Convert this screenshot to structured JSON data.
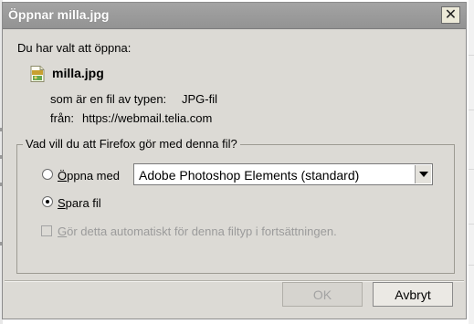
{
  "window": {
    "title": "Öppnar milla.jpg"
  },
  "intro_text": "Du har valt att öppna:",
  "file": {
    "name": "milla.jpg",
    "icon": "jpg-file-icon",
    "type_label": "som är en fil av typen:",
    "type_value": "JPG-fil",
    "from_label": "från:",
    "from_value": "https://webmail.telia.com"
  },
  "action_group": {
    "legend": "Vad vill du att Firefox gör med denna fil?",
    "open_with_label_accel": "Ö",
    "open_with_label_rest": "ppna med",
    "open_with_app": "Adobe Photoshop Elements (standard)",
    "save_label_accel": "S",
    "save_label_rest": "para fil",
    "selected": "save",
    "auto_label_accel": "G",
    "auto_label_rest": "ör detta automatiskt för denna filtyp i fortsättningen.",
    "auto_checked": false,
    "auto_enabled": false
  },
  "buttons": {
    "ok": "OK",
    "ok_enabled": false,
    "cancel": "Avbryt"
  },
  "colors": {
    "titlebar": "#999999",
    "dialog_bg": "#dcdad5",
    "disabled_text": "#9b9b9b"
  }
}
